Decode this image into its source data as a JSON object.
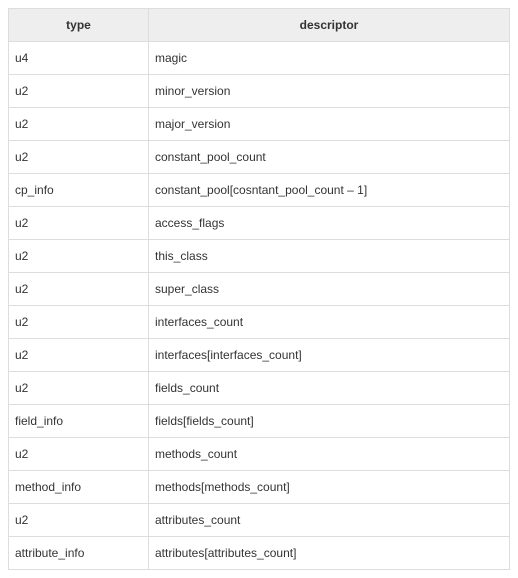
{
  "table": {
    "headers": {
      "type": "type",
      "descriptor": "descriptor"
    },
    "rows": [
      {
        "type": "u4",
        "descriptor": "magic"
      },
      {
        "type": "u2",
        "descriptor": "minor_version"
      },
      {
        "type": "u2",
        "descriptor": "major_version"
      },
      {
        "type": "u2",
        "descriptor": "constant_pool_count"
      },
      {
        "type": "cp_info",
        "descriptor": "constant_pool[cosntant_pool_count – 1]"
      },
      {
        "type": "u2",
        "descriptor": "access_flags"
      },
      {
        "type": "u2",
        "descriptor": "this_class"
      },
      {
        "type": "u2",
        "descriptor": "super_class"
      },
      {
        "type": "u2",
        "descriptor": "interfaces_count"
      },
      {
        "type": "u2",
        "descriptor": "interfaces[interfaces_count]"
      },
      {
        "type": "u2",
        "descriptor": "fields_count"
      },
      {
        "type": "field_info",
        "descriptor": "fields[fields_count]"
      },
      {
        "type": "u2",
        "descriptor": "methods_count"
      },
      {
        "type": "method_info",
        "descriptor": "methods[methods_count]"
      },
      {
        "type": "u2",
        "descriptor": "attributes_count"
      },
      {
        "type": "attribute_info",
        "descriptor": "attributes[attributes_count]"
      }
    ]
  }
}
